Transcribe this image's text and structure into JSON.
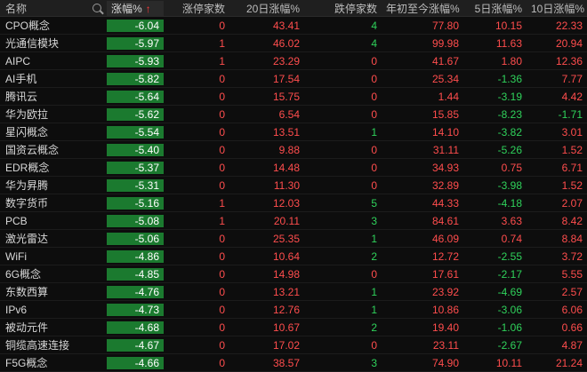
{
  "columns": {
    "name": "名称",
    "change": "涨幅%",
    "sort_arrow": "↑",
    "limit_up": "涨停家数",
    "d20": "20日涨幅%",
    "limit_down": "跌停家数",
    "ytd": "年初至今涨幅%",
    "d5": "5日涨幅%",
    "d10": "10日涨幅%"
  },
  "colors": {
    "up": "#ff4d4d",
    "down": "#2fd25b",
    "change_cell": "#1b7a2f"
  },
  "rows": [
    {
      "name": "CPO概念",
      "change": "-6.04",
      "limit_up": "0",
      "d20": "43.41",
      "limit_down": "4",
      "ytd": "77.80",
      "d5": "10.15",
      "d10": "22.33"
    },
    {
      "name": "光通信模块",
      "change": "-5.97",
      "limit_up": "1",
      "d20": "46.02",
      "limit_down": "4",
      "ytd": "99.98",
      "d5": "11.63",
      "d10": "20.94"
    },
    {
      "name": "AIPC",
      "change": "-5.93",
      "limit_up": "1",
      "d20": "23.29",
      "limit_down": "0",
      "ytd": "41.67",
      "d5": "1.80",
      "d10": "12.36"
    },
    {
      "name": "AI手机",
      "change": "-5.82",
      "limit_up": "0",
      "d20": "17.54",
      "limit_down": "0",
      "ytd": "25.34",
      "d5": "-1.36",
      "d10": "7.77"
    },
    {
      "name": "腾讯云",
      "change": "-5.64",
      "limit_up": "0",
      "d20": "15.75",
      "limit_down": "0",
      "ytd": "1.44",
      "d5": "-3.19",
      "d10": "4.42"
    },
    {
      "name": "华为欧拉",
      "change": "-5.62",
      "limit_up": "0",
      "d20": "6.54",
      "limit_down": "0",
      "ytd": "15.85",
      "d5": "-8.23",
      "d10": "-1.71"
    },
    {
      "name": "星闪概念",
      "change": "-5.54",
      "limit_up": "0",
      "d20": "13.51",
      "limit_down": "1",
      "ytd": "14.10",
      "d5": "-3.82",
      "d10": "3.01"
    },
    {
      "name": "国资云概念",
      "change": "-5.40",
      "limit_up": "0",
      "d20": "9.88",
      "limit_down": "0",
      "ytd": "31.11",
      "d5": "-5.26",
      "d10": "1.52"
    },
    {
      "name": "EDR概念",
      "change": "-5.37",
      "limit_up": "0",
      "d20": "14.48",
      "limit_down": "0",
      "ytd": "34.93",
      "d5": "0.75",
      "d10": "6.71"
    },
    {
      "name": "华为昇腾",
      "change": "-5.31",
      "limit_up": "0",
      "d20": "11.30",
      "limit_down": "0",
      "ytd": "32.89",
      "d5": "-3.98",
      "d10": "1.52"
    },
    {
      "name": "数字货币",
      "change": "-5.16",
      "limit_up": "1",
      "d20": "12.03",
      "limit_down": "5",
      "ytd": "44.33",
      "d5": "-4.18",
      "d10": "2.07"
    },
    {
      "name": "PCB",
      "change": "-5.08",
      "limit_up": "1",
      "d20": "20.11",
      "limit_down": "3",
      "ytd": "84.61",
      "d5": "3.63",
      "d10": "8.42"
    },
    {
      "name": "激光雷达",
      "change": "-5.06",
      "limit_up": "0",
      "d20": "25.35",
      "limit_down": "1",
      "ytd": "46.09",
      "d5": "0.74",
      "d10": "8.84"
    },
    {
      "name": "WiFi",
      "change": "-4.86",
      "limit_up": "0",
      "d20": "10.64",
      "limit_down": "2",
      "ytd": "12.72",
      "d5": "-2.55",
      "d10": "3.72"
    },
    {
      "name": "6G概念",
      "change": "-4.85",
      "limit_up": "0",
      "d20": "14.98",
      "limit_down": "0",
      "ytd": "17.61",
      "d5": "-2.17",
      "d10": "5.55"
    },
    {
      "name": "东数西算",
      "change": "-4.76",
      "limit_up": "0",
      "d20": "13.21",
      "limit_down": "1",
      "ytd": "23.92",
      "d5": "-4.69",
      "d10": "2.57"
    },
    {
      "name": "IPv6",
      "change": "-4.73",
      "limit_up": "0",
      "d20": "12.76",
      "limit_down": "1",
      "ytd": "10.86",
      "d5": "-3.06",
      "d10": "6.06"
    },
    {
      "name": "被动元件",
      "change": "-4.68",
      "limit_up": "0",
      "d20": "10.67",
      "limit_down": "2",
      "ytd": "19.40",
      "d5": "-1.06",
      "d10": "0.66"
    },
    {
      "name": "铜缆高速连接",
      "change": "-4.67",
      "limit_up": "0",
      "d20": "17.02",
      "limit_down": "0",
      "ytd": "23.11",
      "d5": "-2.67",
      "d10": "4.87"
    },
    {
      "name": "F5G概念",
      "change": "-4.66",
      "limit_up": "0",
      "d20": "38.57",
      "limit_down": "3",
      "ytd": "74.90",
      "d5": "10.11",
      "d10": "21.24"
    }
  ]
}
